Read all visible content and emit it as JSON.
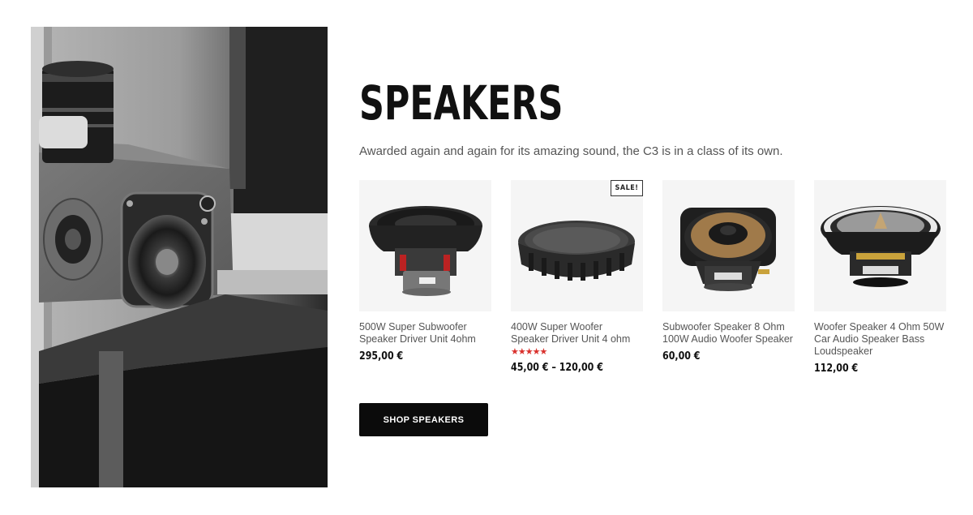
{
  "section": {
    "title": "SPEAKERS",
    "subtitle": "Awarded again and again for its amazing sound, the C3 is in a class of its own.",
    "cta_label": "SHOP SPEAKERS"
  },
  "products": [
    {
      "name": "500W Super Subwoofer Speaker Driver Unit 4ohm",
      "price": "295,00 €",
      "sale": false,
      "rating": null
    },
    {
      "name": "400W Super Woofer Speaker Driver Unit 4 ohm",
      "price": "45,00 € – 120,00 €",
      "sale": true,
      "sale_label": "SALE!",
      "rating": 5,
      "rating_stars": "★★★★★"
    },
    {
      "name": "Subwoofer Speaker 8 Ohm 100W Audio Woofer Speaker",
      "price": "60,00 €",
      "sale": false,
      "rating": null
    },
    {
      "name": "Woofer Speaker 4 Ohm 50W Car Audio Speaker Bass Loudspeaker",
      "price": "112,00 €",
      "sale": false,
      "rating": null
    }
  ],
  "colors": {
    "button_bg": "#0b0b0b",
    "rating_star": "#d9302c",
    "image_bg": "#f5f5f5"
  }
}
